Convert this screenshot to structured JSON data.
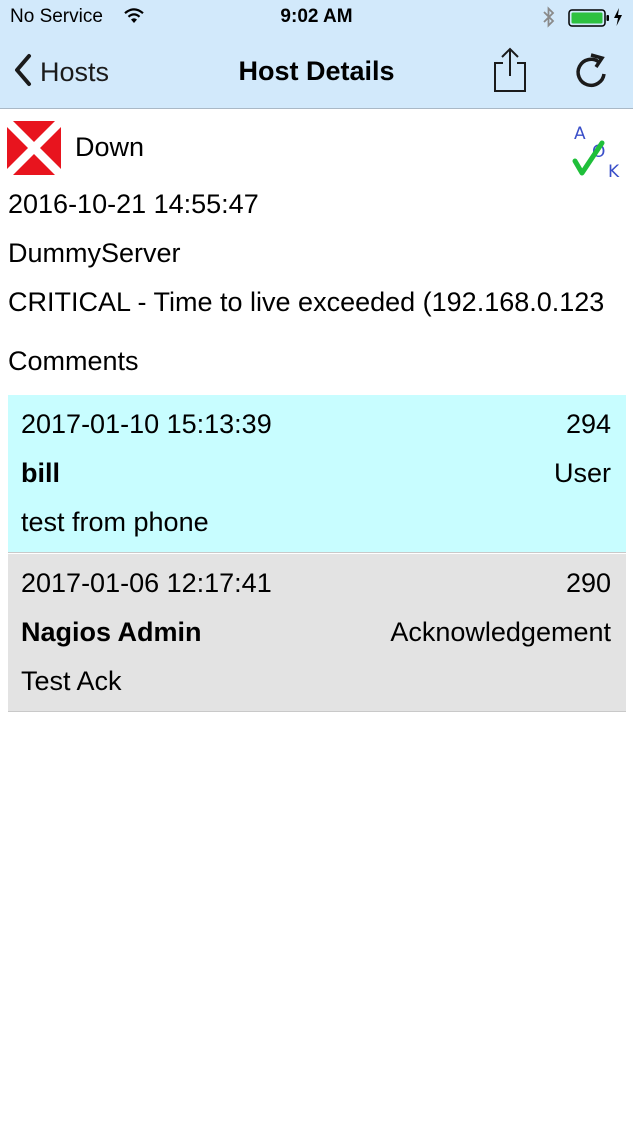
{
  "status_bar": {
    "carrier": "No Service",
    "time": "9:02 AM"
  },
  "nav": {
    "back_label": "Hosts",
    "title": "Host Details"
  },
  "host": {
    "state": "Down",
    "last_check": "2016-10-21 14:55:47",
    "name": "DummyServer",
    "output": "CRITICAL - Time to live exceeded (192.168.0.123"
  },
  "ack_icon_letters": {
    "a": "A",
    "o": "O",
    "k": "K"
  },
  "comments": {
    "header": "Comments",
    "items": [
      {
        "time": "2017-01-10 15:13:39",
        "id": "294",
        "author": "bill",
        "type": "User",
        "text": "test from phone",
        "bg": "#c8fdff"
      },
      {
        "time": "2017-01-06 12:17:41",
        "id": "290",
        "author": "Nagios Admin",
        "type": "Acknowledgement",
        "text": "Test Ack",
        "bg": "#e3e3e3"
      }
    ]
  },
  "colors": {
    "nav_bg": "#d2e9fb",
    "down_red": "#e8141e",
    "ack_check": "#1fbf3a",
    "ack_letters": "#3a4fc9"
  }
}
